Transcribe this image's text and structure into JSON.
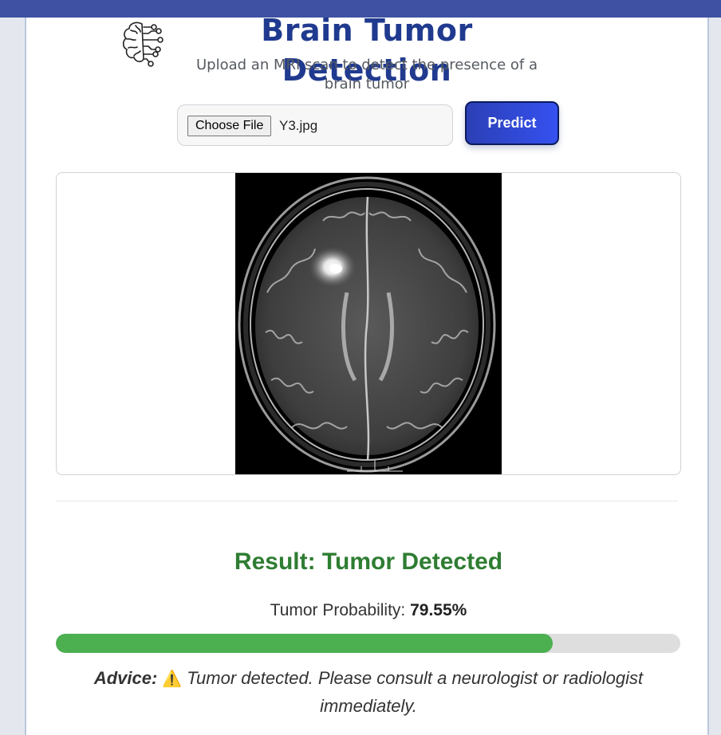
{
  "header": {
    "logo_icon": "brain-circuit-icon",
    "title": "Brain Tumor Detection",
    "subtitle": "Upload an MRI scan to detect the presence of a brain tumor"
  },
  "upload": {
    "choose_label": "Choose File",
    "file_name": "Y3.jpg",
    "predict_label": "Predict"
  },
  "preview": {
    "image_icon": "mri-scan-image"
  },
  "result": {
    "text": "Result: Tumor Detected",
    "probability_label": "Tumor Probability:",
    "probability_value": "79.55%",
    "probability_fraction": 0.7955,
    "advice_label": "Advice:",
    "advice_icon": "warning-icon",
    "advice_text": "Tumor detected. Please consult a neurologist or radiologist immediately."
  },
  "colors": {
    "accent": "#203a8f",
    "success": "#2e7d32",
    "progress": "#4caf50",
    "topbar": "#3f51a3"
  }
}
